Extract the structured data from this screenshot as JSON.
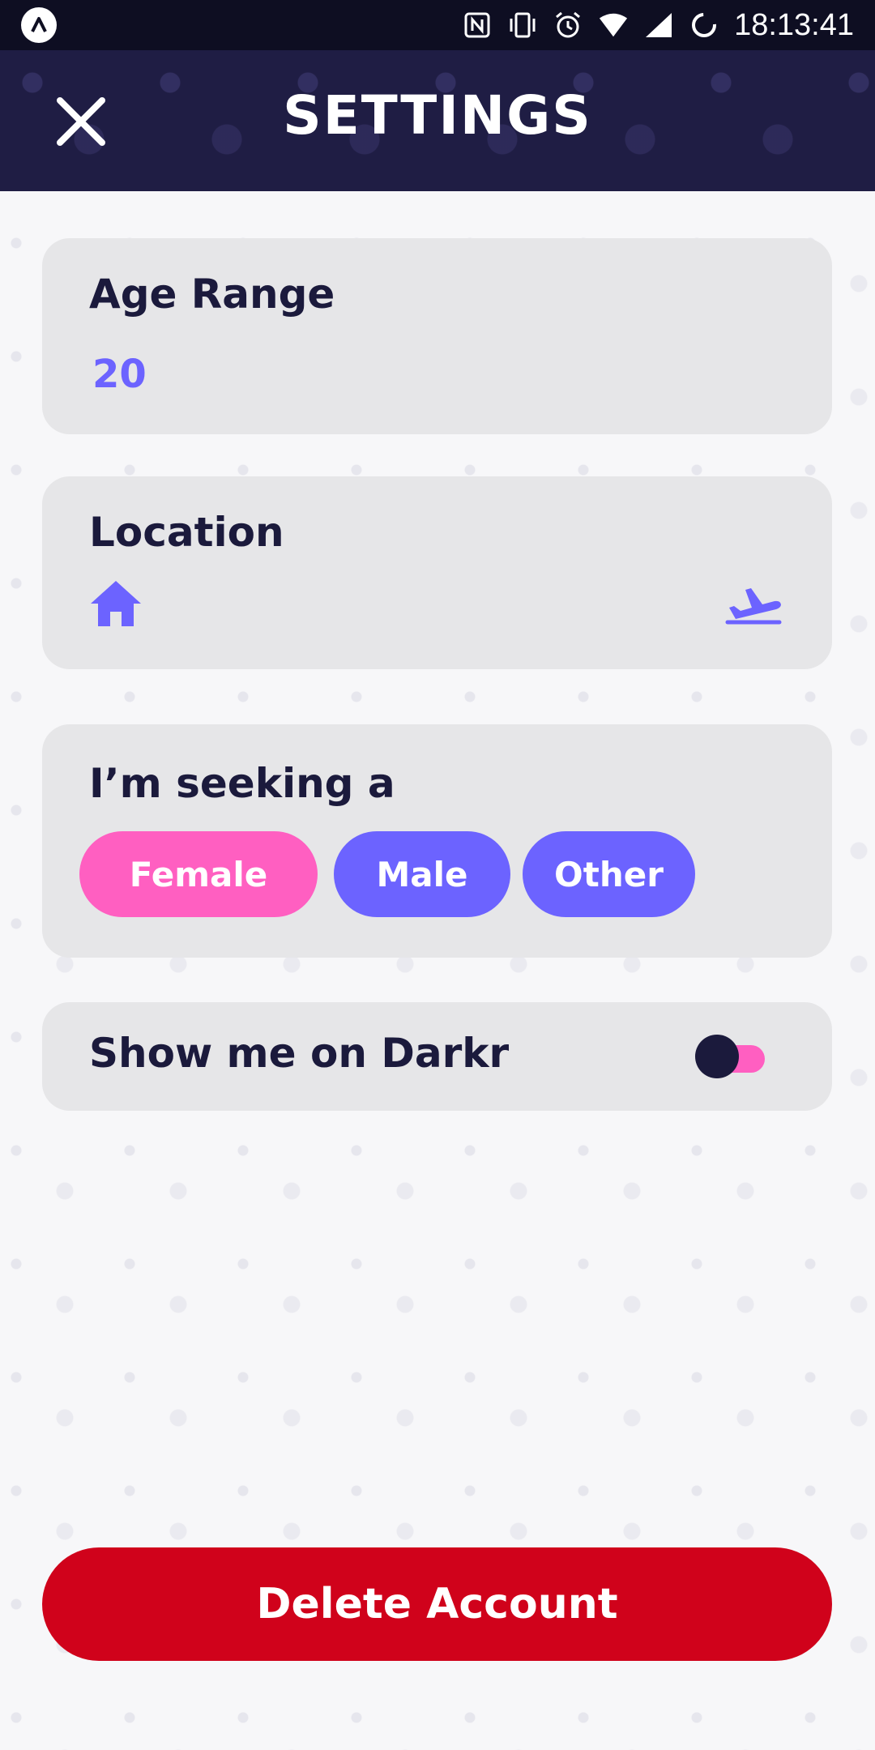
{
  "status_bar": {
    "time": "18:13:41",
    "icons": [
      "app-badge-icon",
      "nfc-icon",
      "vibrate-icon",
      "alarm-icon",
      "wifi-icon",
      "signal-icon",
      "sync-icon"
    ]
  },
  "header": {
    "title": "SETTINGS",
    "close_icon": "close-icon"
  },
  "age_range": {
    "label": "Age Range",
    "value": "20"
  },
  "location": {
    "label": "Location",
    "home_icon": "home-icon",
    "travel_icon": "flight-takeoff-icon"
  },
  "seeking": {
    "label": "I’m seeking a",
    "options": [
      {
        "label": "Female",
        "selected": true
      },
      {
        "label": "Male",
        "selected": false
      },
      {
        "label": "Other",
        "selected": false
      }
    ]
  },
  "visibility": {
    "label": "Show me on Darkr",
    "enabled": false
  },
  "delete": {
    "label": "Delete Account"
  },
  "colors": {
    "header_bg": "#1f1d44",
    "accent_purple": "#6c63ff",
    "accent_pink": "#ff5fc1",
    "text_dark": "#1b1a3c",
    "card_bg": "#e6e6e8",
    "danger": "#d0021b"
  }
}
